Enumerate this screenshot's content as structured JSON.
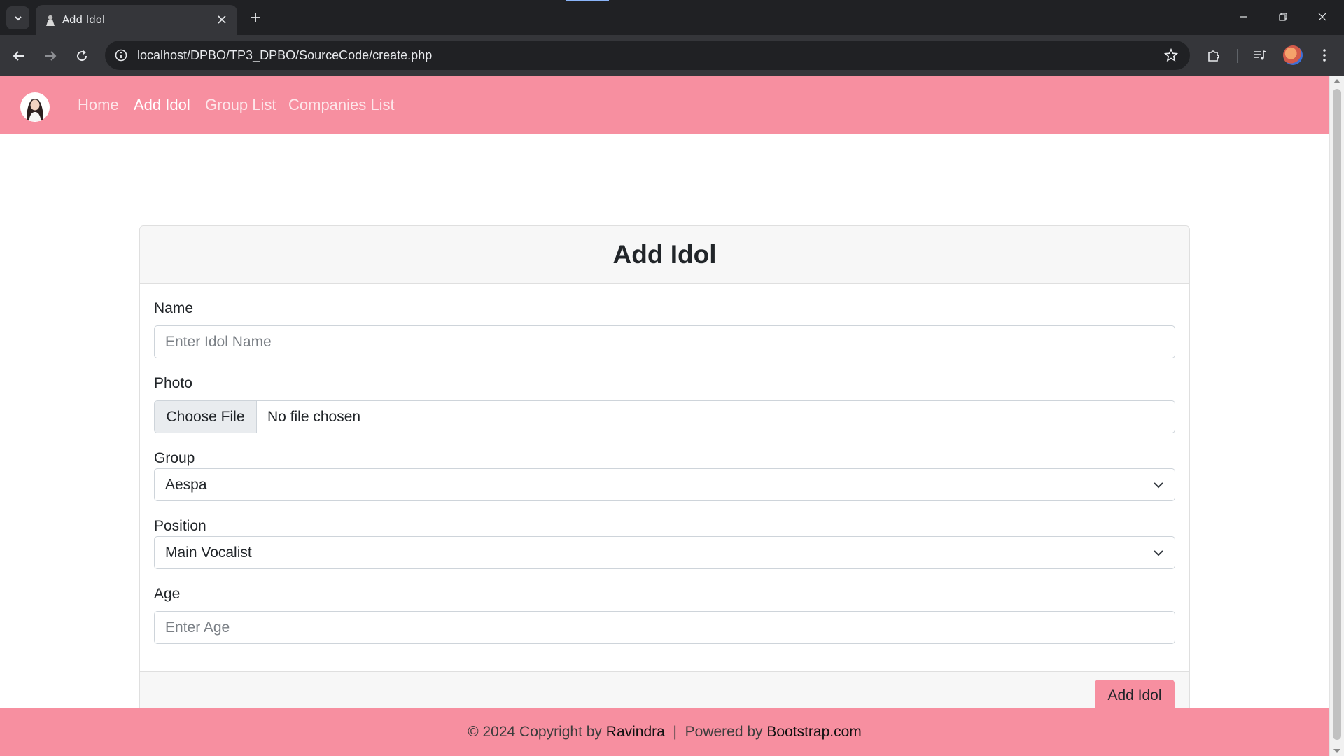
{
  "browser": {
    "tab_title": "Add Idol",
    "url": "localhost/DPBO/TP3_DPBO/SourceCode/create.php"
  },
  "nav": {
    "links": [
      "Home",
      "Add Idol",
      "Group List",
      "Companies List"
    ],
    "active": "Add Idol"
  },
  "form": {
    "title": "Add Idol",
    "name_label": "Name",
    "name_placeholder": "Enter Idol Name",
    "photo_label": "Photo",
    "file_button": "Choose File",
    "file_status": "No file chosen",
    "group_label": "Group",
    "group_value": "Aespa",
    "position_label": "Position",
    "position_value": "Main Vocalist",
    "age_label": "Age",
    "age_placeholder": "Enter Age",
    "submit_label": "Add Idol"
  },
  "footer": {
    "copyright": "© 2024 Copyright by",
    "author": "Ravindra",
    "separator": "|",
    "powered": "Powered by",
    "powered_site": "Bootstrap.com"
  },
  "colors": {
    "brand_pink": "#f78fa0",
    "browser_dark": "#202124",
    "browser_toolbar": "#35363a"
  },
  "icons": [
    "tab-list-icon",
    "favicon-icon",
    "close-icon",
    "plus-icon",
    "minimize-icon",
    "restore-icon",
    "window-close-icon",
    "back-icon",
    "forward-icon",
    "reload-icon",
    "info-icon",
    "star-icon",
    "extensions-icon",
    "media-icon",
    "profile-icon",
    "menu-icon",
    "chevron-down-icon"
  ]
}
